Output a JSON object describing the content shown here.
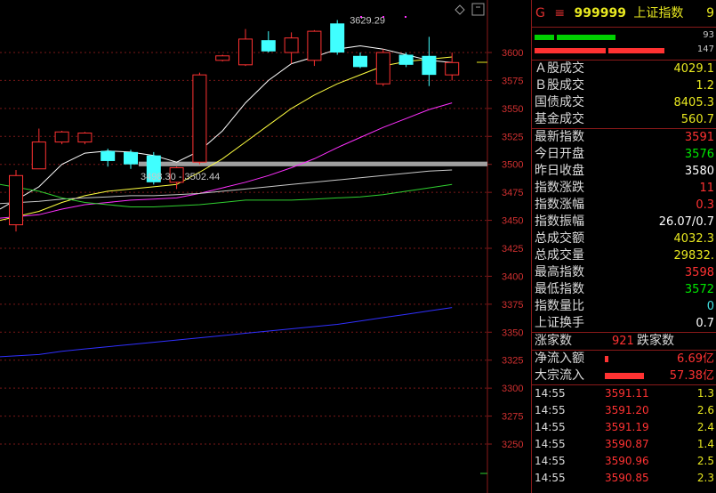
{
  "chart_data": {
    "type": "candlestick",
    "ylim": [
      3225,
      3630
    ],
    "yticks": [
      "3600",
      "3575",
      "3550",
      "3525",
      "3500",
      "3475",
      "3450",
      "3425",
      "3400",
      "3375",
      "3350",
      "3325",
      "3300",
      "3275",
      "3250"
    ],
    "candles": [
      {
        "o": 3446,
        "c": 3490,
        "h": 3495,
        "l": 3440
      },
      {
        "o": 3496,
        "c": 3520,
        "h": 3532,
        "l": 3496
      },
      {
        "o": 3520,
        "c": 3529,
        "h": 3530,
        "l": 3518
      },
      {
        "o": 3520,
        "c": 3528,
        "h": 3529,
        "l": 3518
      },
      {
        "o": 3512,
        "c": 3503,
        "h": 3514,
        "l": 3498
      },
      {
        "o": 3511,
        "c": 3500,
        "h": 3513,
        "l": 3496
      },
      {
        "o": 3508,
        "c": 3484,
        "h": 3511,
        "l": 3482
      },
      {
        "o": 3484,
        "c": 3497,
        "h": 3498,
        "l": 3478
      },
      {
        "o": 3502,
        "c": 3580,
        "h": 3582,
        "l": 3500
      },
      {
        "o": 3593,
        "c": 3597,
        "h": 3598,
        "l": 3592
      },
      {
        "o": 3589,
        "c": 3612,
        "h": 3621,
        "l": 3588
      },
      {
        "o": 3611,
        "c": 3601,
        "h": 3619,
        "l": 3600
      },
      {
        "o": 3600,
        "c": 3613,
        "h": 3618,
        "l": 3590
      },
      {
        "o": 3593,
        "c": 3619,
        "h": 3620,
        "l": 3588
      },
      {
        "o": 3626,
        "c": 3600,
        "h": 3629,
        "l": 3598
      },
      {
        "o": 3597,
        "c": 3587,
        "h": 3600,
        "l": 3586
      },
      {
        "o": 3572,
        "c": 3600,
        "h": 3603,
        "l": 3570
      },
      {
        "o": 3598,
        "c": 3589,
        "h": 3600,
        "l": 3587
      },
      {
        "o": 3597,
        "c": 3580,
        "h": 3614,
        "l": 3570
      },
      {
        "o": 3580,
        "c": 3591,
        "h": 3600,
        "l": 3575
      }
    ],
    "ma_series": [
      {
        "color": "#ffffff",
        "values": [
          3460,
          3480,
          3500,
          3510,
          3512,
          3511,
          3508,
          3502,
          3512,
          3530,
          3555,
          3575,
          3590,
          3596,
          3603,
          3606,
          3603,
          3598,
          3593,
          3591
        ]
      },
      {
        "color": "#ffff40",
        "values": [
          3450,
          3458,
          3466,
          3472,
          3476,
          3478,
          3480,
          3482,
          3493,
          3505,
          3520,
          3535,
          3550,
          3562,
          3572,
          3580,
          3588,
          3592,
          3594,
          3596
        ]
      },
      {
        "color": "#ff30ff",
        "values": [
          3452,
          3455,
          3460,
          3464,
          3466,
          3468,
          3469,
          3470,
          3474,
          3479,
          3484,
          3490,
          3497,
          3505,
          3515,
          3524,
          3533,
          3541,
          3549,
          3555
        ]
      },
      {
        "color": "#c8c8c8",
        "values": [
          3465,
          3467,
          3469,
          3470,
          3471,
          3472,
          3472,
          3473,
          3474,
          3476,
          3478,
          3480,
          3482,
          3484,
          3486,
          3488,
          3490,
          3492,
          3494,
          3495
        ]
      },
      {
        "color": "#30d030",
        "values": [
          3482,
          3476,
          3470,
          3466,
          3464,
          3462,
          3462,
          3463,
          3464,
          3466,
          3468,
          3468,
          3468,
          3469,
          3470,
          3471,
          3473,
          3476,
          3479,
          3482
        ]
      },
      {
        "color": "#3030ff",
        "values": [
          3328,
          3330,
          3333,
          3335,
          3337,
          3339,
          3341,
          3343,
          3345,
          3347,
          3349,
          3351,
          3353,
          3355,
          3357,
          3360,
          3363,
          3366,
          3369,
          3372
        ]
      }
    ],
    "range_band": [
      3498.3,
      3502.44
    ],
    "annotations": {
      "high_label": "3629.29",
      "band_label": "3498.30 - 3502.44"
    }
  },
  "panel": {
    "letter": "G",
    "menu": "≡",
    "code": "999999",
    "name": "上证指数",
    "tail": "9",
    "bar_nums": [
      "93",
      "147"
    ],
    "s1": [
      {
        "l": "Ａ股成交",
        "v": "4029.1",
        "c": "yel"
      },
      {
        "l": "Ｂ股成交",
        "v": "1.2",
        "c": "yel"
      },
      {
        "l": "国债成交",
        "v": "8405.3",
        "c": "yel"
      },
      {
        "l": "基金成交",
        "v": "560.7",
        "c": "yel"
      }
    ],
    "s2": [
      {
        "l": "最新指数",
        "v": "3591",
        "c": "red"
      },
      {
        "l": "今日开盘",
        "v": "3576",
        "c": "grn"
      },
      {
        "l": "昨日收盘",
        "v": "3580",
        "c": "wht"
      },
      {
        "l": "指数涨跌",
        "v": "11",
        "c": "red"
      },
      {
        "l": "指数涨幅",
        "v": "0.3",
        "c": "red"
      },
      {
        "l": "指数振幅",
        "v": "26.07/0.7",
        "c": "wht"
      },
      {
        "l": "总成交额",
        "v": "4032.3",
        "c": "yel"
      },
      {
        "l": "总成交量",
        "v": "29832.",
        "c": "yel"
      },
      {
        "l": "最高指数",
        "v": "3598",
        "c": "red"
      },
      {
        "l": "最低指数",
        "v": "3572",
        "c": "grn"
      },
      {
        "l": "指数量比",
        "v": "0",
        "c": "cyan"
      },
      {
        "l": "上证换手",
        "v": "0.7",
        "c": "wht"
      }
    ],
    "rise_label": "涨家数",
    "rise_val": "921",
    "fall_label": "跌家数",
    "flow1_label": "净流入额",
    "flow1_val": "6.69亿",
    "flow2_label": "大宗流入",
    "flow2_val": "57.38亿",
    "ticks": [
      {
        "t": "14:55",
        "p": "3591.11",
        "v": "1.3"
      },
      {
        "t": "14:55",
        "p": "3591.20",
        "v": "2.6"
      },
      {
        "t": "14:55",
        "p": "3591.19",
        "v": "2.4"
      },
      {
        "t": "14:55",
        "p": "3590.87",
        "v": "1.4"
      },
      {
        "t": "14:55",
        "p": "3590.96",
        "v": "2.5"
      },
      {
        "t": "14:55",
        "p": "3590.85",
        "v": "2.3"
      }
    ]
  }
}
